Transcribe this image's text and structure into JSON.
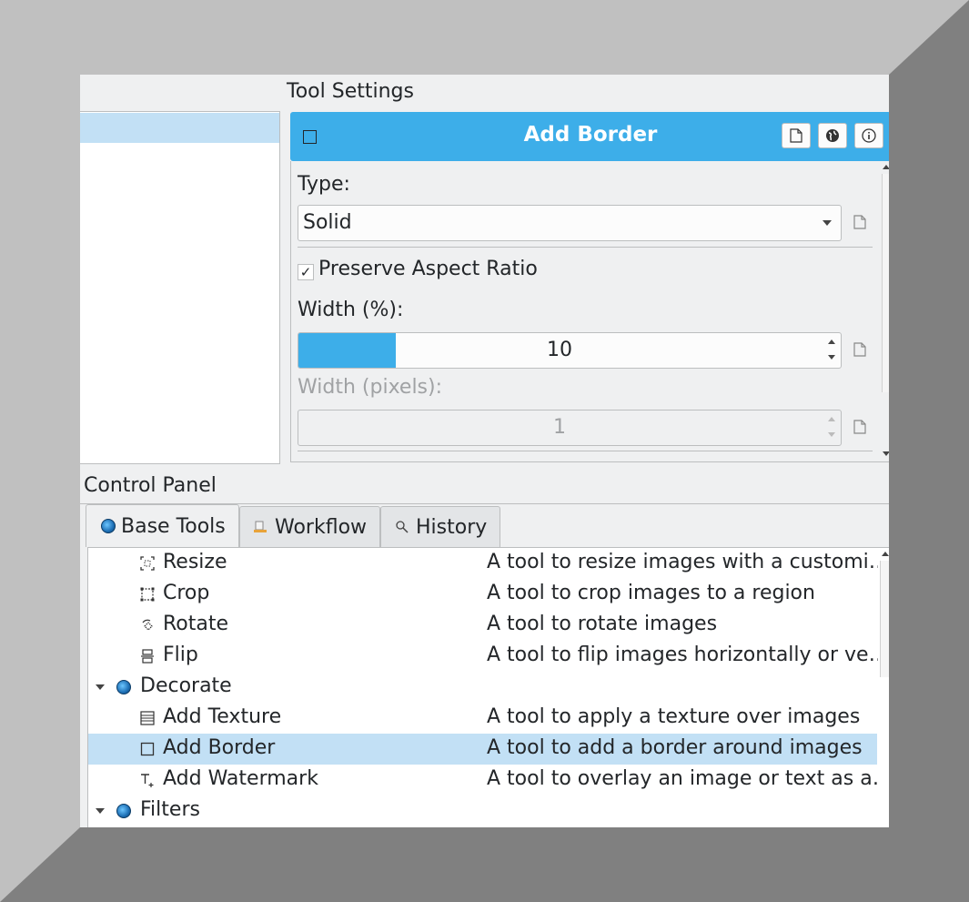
{
  "tool_settings": {
    "title": "Tool Settings",
    "header_title": "Add Border",
    "type_label": "Type:",
    "type_value": "Solid",
    "preserve_aspect": {
      "label": "Preserve Aspect Ratio",
      "checked": true
    },
    "width_percent_label": "Width (%):",
    "width_percent_value": "10",
    "width_percent_fill": 0.18,
    "width_pixels_label": "Width (pixels):",
    "width_pixels_value": "1"
  },
  "control_panel": {
    "title": "Control Panel",
    "tabs": [
      {
        "label": "Base Tools",
        "icon": "globe-icon"
      },
      {
        "label": "Workflow",
        "icon": "workflow-icon"
      },
      {
        "label": "History",
        "icon": "magnifier-icon"
      }
    ],
    "rows": [
      {
        "name": "Resize",
        "desc": "A tool to resize images with a customi…",
        "icon": "resize-icon",
        "level": 2
      },
      {
        "name": "Crop",
        "desc": "A tool to crop images to a region",
        "icon": "crop-icon",
        "level": 2
      },
      {
        "name": "Rotate",
        "desc": "A tool to rotate images",
        "icon": "rotate-icon",
        "level": 2
      },
      {
        "name": "Flip",
        "desc": "A tool to flip images horizontally or ve…",
        "icon": "flip-icon",
        "level": 2
      },
      {
        "name": "Decorate",
        "desc": "",
        "icon": "globe-icon",
        "level": 1
      },
      {
        "name": "Add Texture",
        "desc": "A tool to apply a texture over images",
        "icon": "texture-icon",
        "level": 2
      },
      {
        "name": "Add Border",
        "desc": "A tool to add a border around images",
        "icon": "border-icon",
        "level": 2,
        "selected": true
      },
      {
        "name": "Add Watermark",
        "desc": "A tool to overlay an image or text as a…",
        "icon": "watermark-icon",
        "level": 2
      },
      {
        "name": "Filters",
        "desc": "",
        "icon": "globe-icon",
        "level": 1
      }
    ]
  },
  "colors": {
    "accent": "#3daee9",
    "selection": "#c2e0f5"
  }
}
